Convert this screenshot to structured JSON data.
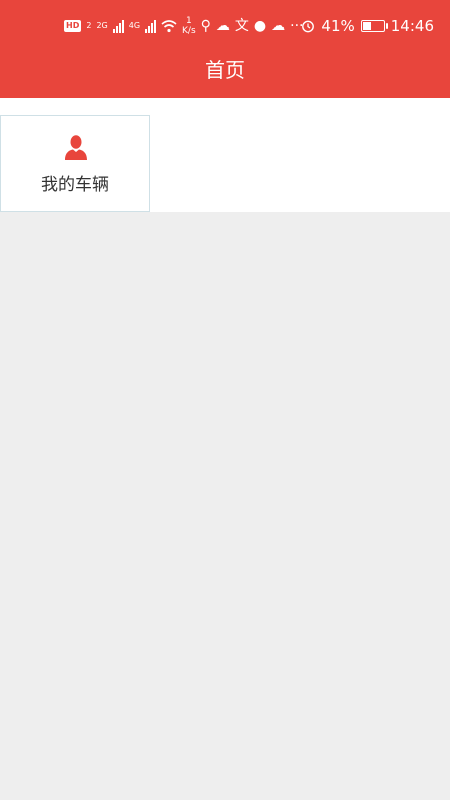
{
  "status_bar": {
    "hd_label": "HD",
    "sim_num": "2",
    "net1": "2G",
    "net2": "4G",
    "speed_value": "1",
    "speed_unit": "K/s",
    "battery_percent": "41%",
    "battery_level": 0.41,
    "time": "14:46"
  },
  "header": {
    "title": "首页"
  },
  "tiles": [
    {
      "label": "我的车辆",
      "icon": "person-icon"
    }
  ],
  "colors": {
    "brand_red": "#e8453c",
    "background": "#eeeeee",
    "tile_border": "#cfe0e6"
  }
}
